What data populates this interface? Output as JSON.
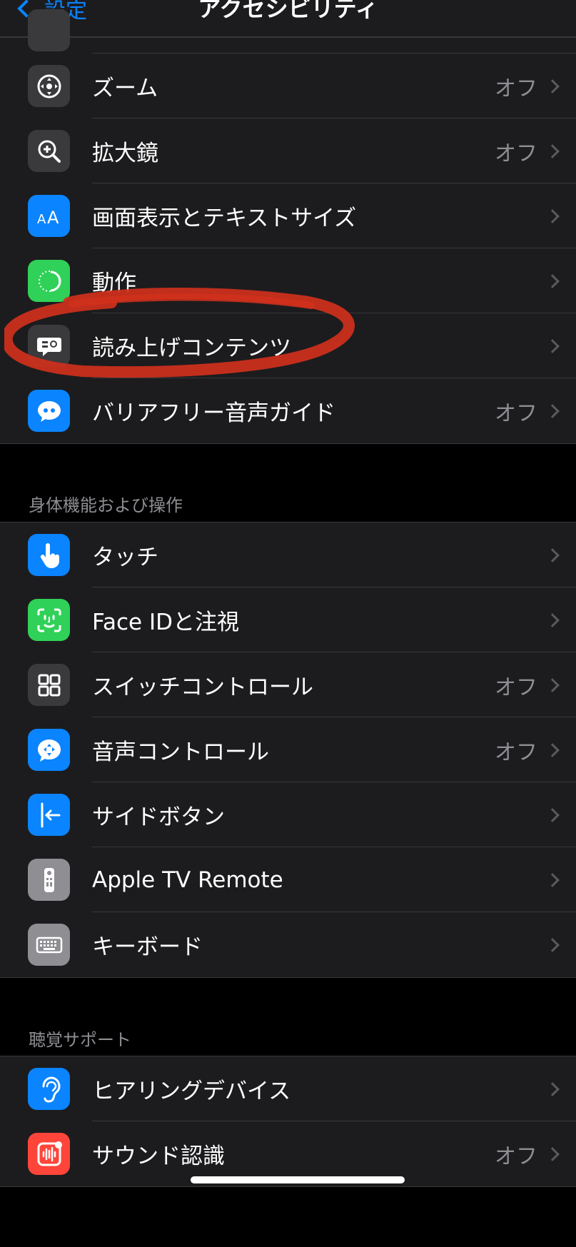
{
  "nav": {
    "back_label": "設定",
    "title": "アクセシビリティ"
  },
  "vision": {
    "items": [
      {
        "label": "ズーム",
        "value": "オフ",
        "icon": "zoom-icon",
        "color": "#3a3a3c"
      },
      {
        "label": "拡大鏡",
        "value": "オフ",
        "icon": "magnifier-icon",
        "color": "#3a3a3c"
      },
      {
        "label": "画面表示とテキストサイズ",
        "value": "",
        "icon": "text-size-icon",
        "color": "#0a84ff"
      },
      {
        "label": "動作",
        "value": "",
        "icon": "motion-icon",
        "color": "#30d158"
      },
      {
        "label": "読み上げコンテンツ",
        "value": "",
        "icon": "spoken-content-icon",
        "color": "#3a3a3c"
      },
      {
        "label": "バリアフリー音声ガイド",
        "value": "オフ",
        "icon": "audio-description-icon",
        "color": "#0a84ff"
      }
    ]
  },
  "physical": {
    "header": "身体機能および操作",
    "items": [
      {
        "label": "タッチ",
        "value": "",
        "icon": "touch-icon",
        "color": "#0a84ff"
      },
      {
        "label": "Face IDと注視",
        "value": "",
        "icon": "face-id-icon",
        "color": "#30d158"
      },
      {
        "label": "スイッチコントロール",
        "value": "オフ",
        "icon": "switch-control-icon",
        "color": "#3a3a3c"
      },
      {
        "label": "音声コントロール",
        "value": "オフ",
        "icon": "voice-control-icon",
        "color": "#0a84ff"
      },
      {
        "label": "サイドボタン",
        "value": "",
        "icon": "side-button-icon",
        "color": "#0a84ff"
      },
      {
        "label": "Apple TV Remote",
        "value": "",
        "icon": "tv-remote-icon",
        "color": "#8e8e93"
      },
      {
        "label": "キーボード",
        "value": "",
        "icon": "keyboard-icon",
        "color": "#8e8e93"
      }
    ]
  },
  "hearing": {
    "header": "聴覚サポート",
    "items": [
      {
        "label": "ヒアリングデバイス",
        "value": "",
        "icon": "ear-icon",
        "color": "#0a84ff"
      },
      {
        "label": "サウンド認識",
        "value": "オフ",
        "icon": "sound-recognition-icon",
        "color": "#ff453a"
      }
    ]
  },
  "annotation_color": "#d0301c"
}
